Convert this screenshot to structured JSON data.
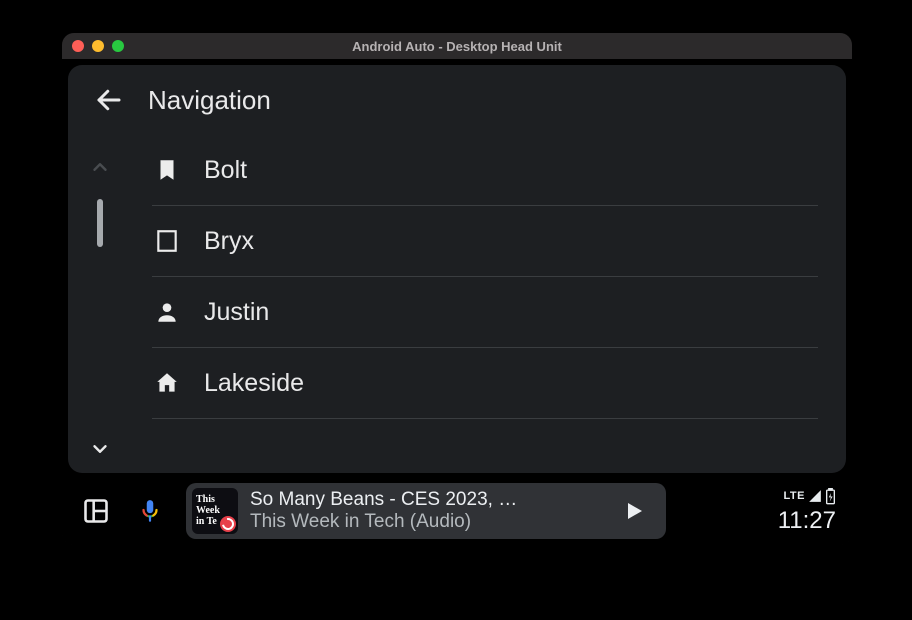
{
  "window": {
    "title": "Android Auto - Desktop Head Unit"
  },
  "header": {
    "title": "Navigation"
  },
  "list": {
    "items": [
      {
        "icon": "bookmark",
        "label": "Bolt"
      },
      {
        "icon": "building",
        "label": "Bryx"
      },
      {
        "icon": "person",
        "label": "Justin"
      },
      {
        "icon": "home",
        "label": "Lakeside"
      }
    ]
  },
  "media": {
    "album_line1": "This",
    "album_line2": "Week",
    "album_line3": "in Te",
    "title": "So Many Beans - CES 2023, …",
    "subtitle": "This Week in Tech (Audio)"
  },
  "status": {
    "network": "LTE",
    "clock": "11:27"
  }
}
